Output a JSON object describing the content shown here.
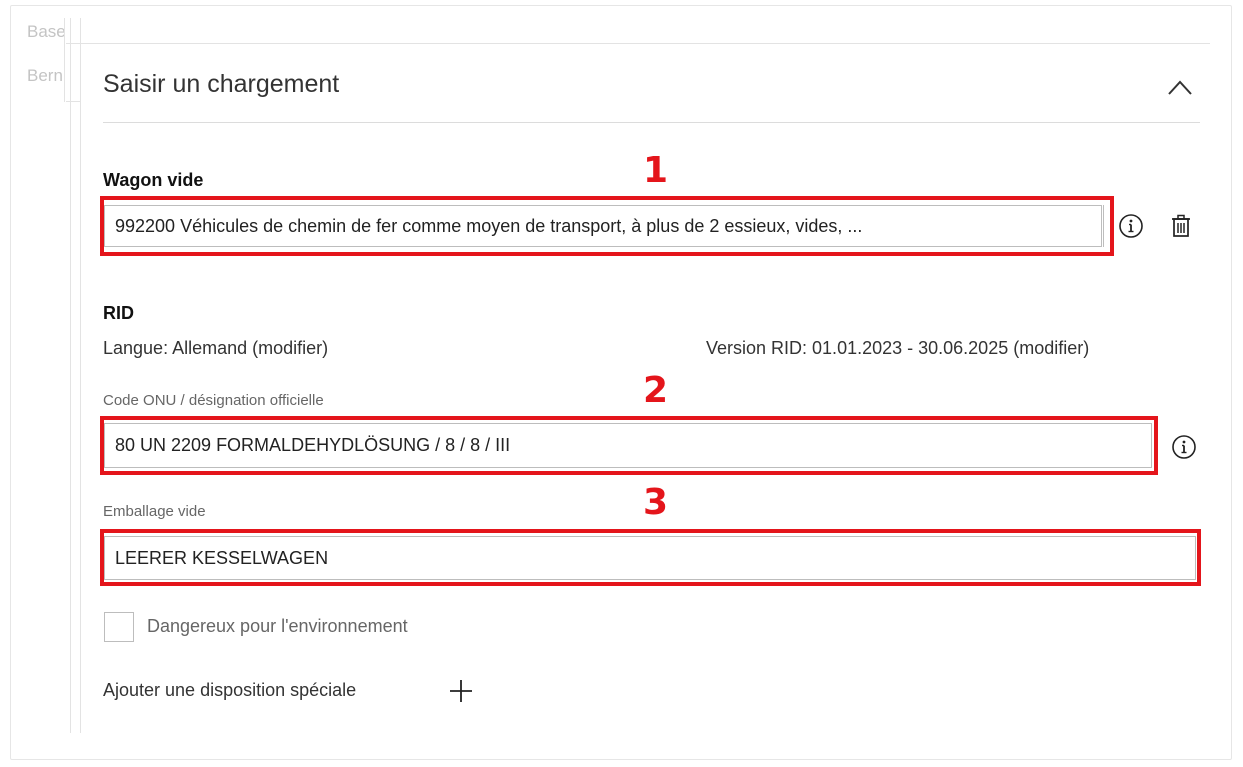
{
  "background": {
    "partial_texts": [
      "Base",
      "Bern"
    ]
  },
  "panel": {
    "title": "Saisir un chargement"
  },
  "wagon": {
    "label": "Wagon vide",
    "value": "992200 Véhicules de chemin de fer comme moyen de transport, à plus de 2 essieux, vides, ..."
  },
  "rid": {
    "label": "RID",
    "language": "Langue: Allemand (modifier)",
    "version": "Version RID: 01.01.2023 - 30.06.2025 (modifier)"
  },
  "onu": {
    "label": "Code ONU / désignation officielle",
    "value": "80 UN 2209 FORMALDEHYDLÖSUNG / 8 / 8 / III"
  },
  "emballage": {
    "label": "Emballage vide",
    "value": "LEERER KESSELWAGEN"
  },
  "environment": {
    "checkbox_label": "Dangereux pour l'environnement",
    "checked": false
  },
  "special": {
    "add_label": "Ajouter une disposition spéciale"
  },
  "annotations": {
    "labels": [
      "1",
      "2",
      "3"
    ],
    "color": "#e4151b"
  },
  "icons": [
    "chevron-up-icon",
    "info-icon",
    "trash-icon",
    "plus-icon"
  ]
}
